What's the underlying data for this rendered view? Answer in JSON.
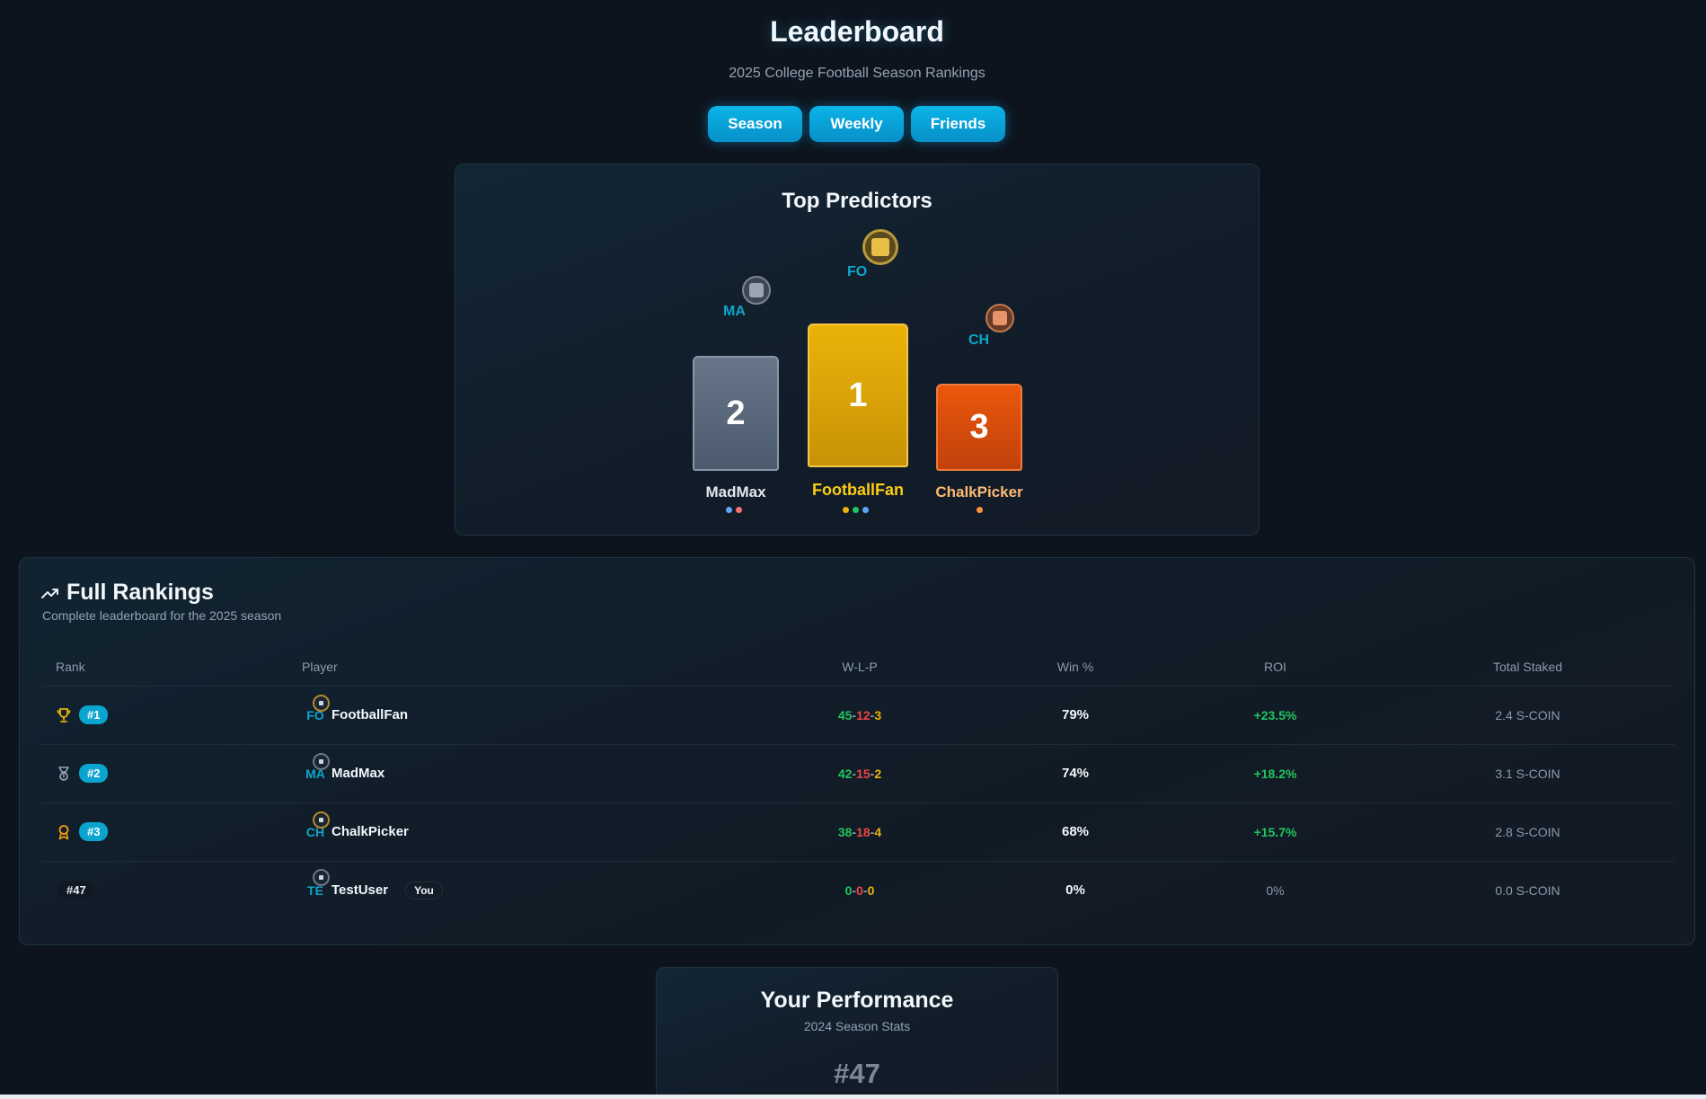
{
  "header": {
    "title": "Leaderboard",
    "subtitle": "2025 College Football Season Rankings",
    "tabs": [
      "Season",
      "Weekly",
      "Friends"
    ]
  },
  "podium": {
    "title": "Top Predictors",
    "first": {
      "rank": "1",
      "name": "FootballFan",
      "initials": "FO",
      "name_color": "#facc15",
      "dot_colors": [
        "#eab308",
        "#22c55e",
        "#60a5fa"
      ]
    },
    "second": {
      "rank": "2",
      "name": "MadMax",
      "initials": "MA",
      "name_color": "#e2e8f0",
      "dot_colors": [
        "#60a5fa",
        "#f87171"
      ]
    },
    "third": {
      "rank": "3",
      "name": "ChalkPicker",
      "initials": "CH",
      "name_color": "#fdba74",
      "dot_colors": [
        "#fb923c"
      ]
    }
  },
  "rankings": {
    "title": "Full Rankings",
    "description": "Complete leaderboard for the 2025 season",
    "columns": [
      "Rank",
      "Player",
      "W-L-P",
      "Win %",
      "ROI",
      "Total Staked"
    ],
    "rows": [
      {
        "icon": "trophy-icon",
        "rank": "#1",
        "initials": "FO",
        "name": "FootballFan",
        "w": "45",
        "l": "12",
        "p": "3",
        "win_pct": "79%",
        "roi": "+23.5%",
        "staked": "2.4 S-COIN",
        "you": ""
      },
      {
        "icon": "medal-icon",
        "rank": "#2",
        "initials": "MA",
        "name": "MadMax",
        "w": "42",
        "l": "15",
        "p": "2",
        "win_pct": "74%",
        "roi": "+18.2%",
        "staked": "3.1 S-COIN",
        "you": ""
      },
      {
        "icon": "award-icon",
        "rank": "#3",
        "initials": "CH",
        "name": "ChalkPicker",
        "w": "38",
        "l": "18",
        "p": "4",
        "win_pct": "68%",
        "roi": "+15.7%",
        "staked": "2.8 S-COIN",
        "you": ""
      },
      {
        "icon": "",
        "rank": "#47",
        "initials": "TE",
        "name": "TestUser",
        "w": "0",
        "l": "0",
        "p": "0",
        "win_pct": "0%",
        "roi": "0%",
        "staked": "0.0 S-COIN",
        "you": "You"
      }
    ]
  },
  "performance": {
    "title": "Your Performance",
    "subtitle": "2024 Season Stats",
    "rank": "#47"
  },
  "colors": {
    "accent": "#0ab4e8",
    "gold": "#eab308",
    "silver": "#64748b",
    "bronze": "#ea580c",
    "win": "#22c55e",
    "loss": "#ef4444",
    "push": "#eab308"
  }
}
